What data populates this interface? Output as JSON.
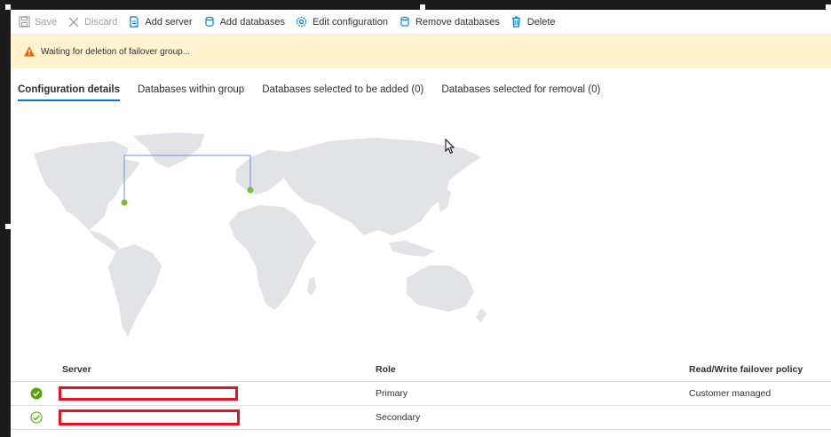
{
  "toolbar": {
    "items": [
      {
        "label": "Save",
        "icon": "save-icon",
        "enabled": false
      },
      {
        "label": "Discard",
        "icon": "discard-icon",
        "enabled": false
      },
      {
        "label": "Add server",
        "icon": "add-server-icon",
        "enabled": true
      },
      {
        "label": "Add databases",
        "icon": "add-databases-icon",
        "enabled": true
      },
      {
        "label": "Edit configuration",
        "icon": "gear-icon",
        "enabled": true
      },
      {
        "label": "Remove databases",
        "icon": "remove-databases-icon",
        "enabled": true
      },
      {
        "label": "Delete",
        "icon": "trash-icon",
        "enabled": true
      }
    ]
  },
  "banner": {
    "message": "Waiting for deletion of failover group...",
    "icon": "warning-icon",
    "color": "#fff4ce"
  },
  "tabs": [
    {
      "label": "Configuration details",
      "active": true
    },
    {
      "label": "Databases within group",
      "active": false
    },
    {
      "label": "Databases selected to be added (0)",
      "active": false
    },
    {
      "label": "Databases selected for removal (0)",
      "active": false
    }
  ],
  "map": {
    "land_color": "#e1e3e6",
    "link_color": "#8ea2e2",
    "marker_color": "#7cbb3a"
  },
  "table": {
    "headers": [
      "Server",
      "Role",
      "Read/Write failover policy"
    ],
    "rows": [
      {
        "status_icon": "check-circle-filled-icon",
        "server": "",
        "role": "Primary",
        "policy": "Customer managed"
      },
      {
        "status_icon": "check-circle-outline-icon",
        "server": "",
        "role": "Secondary",
        "policy": ""
      }
    ]
  },
  "accent_color": "#0078d4",
  "redaction_color": "#e81123"
}
